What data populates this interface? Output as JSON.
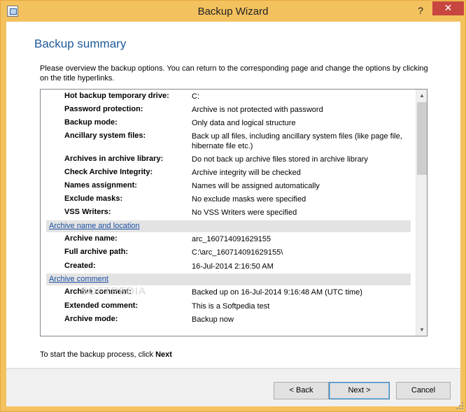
{
  "window": {
    "title": "Backup Wizard",
    "help_glyph": "?",
    "close_glyph": "✕"
  },
  "page": {
    "heading": "Backup summary",
    "intro": "Please overview the backup options. You can return to the corresponding page and change the options by clicking on the title hyperlinks."
  },
  "summary": {
    "rows": [
      {
        "label": "Hot backup temporary drive:",
        "value": "C:"
      },
      {
        "label": "Password protection:",
        "value": "Archive is not protected with password"
      },
      {
        "label": "Backup mode:",
        "value": "Only data and logical structure"
      },
      {
        "label": "Ancillary system files:",
        "value": "Back up all files, including ancillary system files (like page file, hibernate file etc.)"
      },
      {
        "label": "Archives in archive library:",
        "value": "Do not back up archive files stored in archive library"
      },
      {
        "label": "Check Archive Integrity:",
        "value": "Archive integrity will be checked"
      },
      {
        "label": "Names assignment:",
        "value": "Names will be assigned automatically"
      },
      {
        "label": "Exclude masks:",
        "value": "No exclude masks were specified"
      },
      {
        "label": "VSS Writers:",
        "value": "No VSS Writers were specified"
      }
    ],
    "section_archive_name": "Archive name and location",
    "archive_rows": [
      {
        "label": "Archive name:",
        "value": "arc_160714091629155"
      },
      {
        "label": "Full archive path:",
        "value": "C:\\arc_160714091629155\\"
      },
      {
        "label": "Created:",
        "value": "16-Jul-2014 2:16:50 AM"
      }
    ],
    "section_archive_comment": "Archive comment",
    "comment_rows": [
      {
        "label": "Archive comment:",
        "value": "Backed up on 16-Jul-2014 9:16:48 AM (UTC time)"
      },
      {
        "label": "Extended comment:",
        "value": "This is a Softpedia test"
      },
      {
        "label": "Archive mode:",
        "value": "Backup now"
      }
    ],
    "scroll_up_glyph": "▲",
    "scroll_down_glyph": "▼",
    "watermark": "SOFTPEDIA"
  },
  "footer": {
    "instruction_prefix": "To start the backup process, click ",
    "instruction_bold": "Next"
  },
  "buttons": {
    "back": "< Back",
    "next": "Next >",
    "cancel": "Cancel"
  }
}
